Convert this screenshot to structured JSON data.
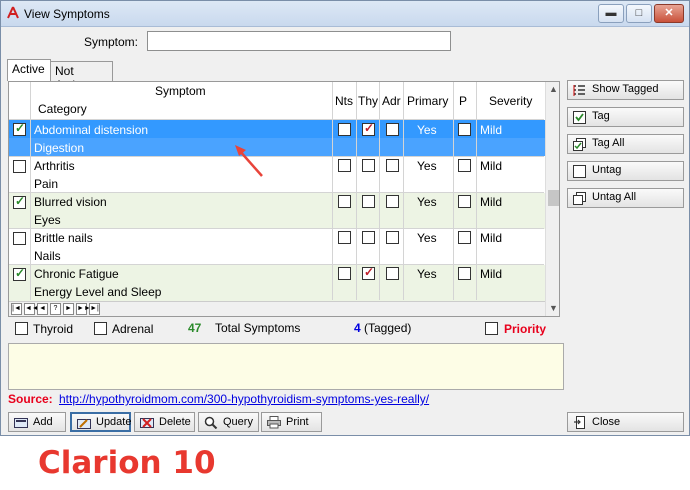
{
  "window": {
    "title": "View Symptoms"
  },
  "search": {
    "label": "Symptom:",
    "value": ""
  },
  "tabs": [
    {
      "label": "Active"
    },
    {
      "label": "Not Active"
    }
  ],
  "grid": {
    "headers": {
      "symptom": "Symptom",
      "category": "Category",
      "nts": "Nts",
      "thy": "Thy",
      "adr": "Adr",
      "primary": "Primary",
      "p": "P",
      "severity": "Severity"
    },
    "rows": [
      {
        "tagged": true,
        "symptom": "Abdominal distension",
        "category": "Digestion",
        "nts": false,
        "thy": true,
        "adr": false,
        "primary": "Yes",
        "p": false,
        "severity": "Mild",
        "selected": true
      },
      {
        "tagged": false,
        "symptom": "Arthritis",
        "category": "Pain",
        "nts": false,
        "thy": false,
        "adr": false,
        "primary": "Yes",
        "p": false,
        "severity": "Mild",
        "selected": false
      },
      {
        "tagged": true,
        "symptom": "Blurred vision",
        "category": "Eyes",
        "nts": false,
        "thy": false,
        "adr": false,
        "primary": "Yes",
        "p": false,
        "severity": "Mild",
        "selected": false
      },
      {
        "tagged": false,
        "symptom": "Brittle nails",
        "category": "Nails",
        "nts": false,
        "thy": false,
        "adr": false,
        "primary": "Yes",
        "p": false,
        "severity": "Mild",
        "selected": false
      },
      {
        "tagged": true,
        "symptom": "Chronic Fatigue",
        "category": "Energy Level and Sleep",
        "nts": false,
        "thy": true,
        "adr": false,
        "primary": "Yes",
        "p": false,
        "severity": "Mild",
        "selected": false
      }
    ],
    "nav_buttons": [
      "|◄",
      "◄◄",
      "◄",
      "?",
      "►",
      "►►",
      "►|"
    ]
  },
  "filters": {
    "thyroid_label": "Thyroid",
    "adrenal_label": "Adrenal",
    "total_count": "47",
    "total_label": "Total Symptoms",
    "tagged_count": "4",
    "tagged_label": "(Tagged)",
    "priority_label": "Priority"
  },
  "side_buttons": {
    "show_tagged": "Show Tagged",
    "tag": "Tag",
    "tag_all": "Tag All",
    "untag": "Untag",
    "untag_all": "Untag All"
  },
  "source": {
    "label": "Source:",
    "url": "http://hypothyroidmom.com/300-hypothyroidism-symptoms-yes-really/"
  },
  "bottom_buttons": {
    "add": "Add",
    "update": "Update",
    "delete": "Delete",
    "query": "Query",
    "print": "Print",
    "close": "Close"
  },
  "caption": "Clarion 10",
  "colors": {
    "selection": "#3399ff",
    "alt_row": "#edf4e4",
    "accent_red": "#e8001c",
    "total_green": "#2a8a2a",
    "tagged_blue": "#0000e0"
  },
  "icons": {
    "app": "clarion-app-icon",
    "arrow": "red-annotation-arrow"
  }
}
